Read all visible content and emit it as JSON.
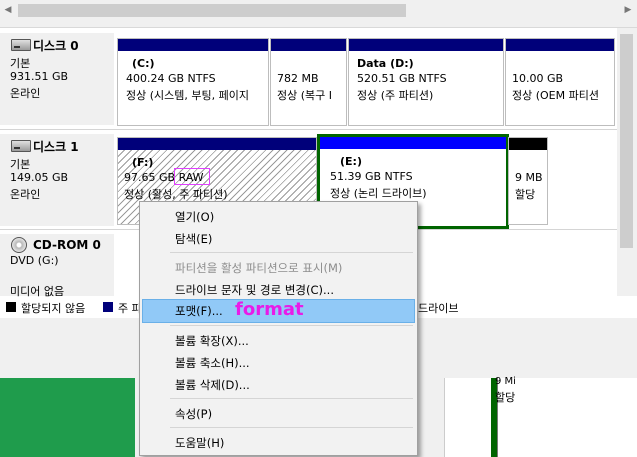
{
  "disks": [
    {
      "title": "디스크 0",
      "type": "기본",
      "size": "931.51 GB",
      "status": "온라인",
      "partitions": [
        {
          "name": "(C:)",
          "size": "400.24 GB NTFS",
          "status": "정상 (시스템, 부팅, 페이지"
        },
        {
          "name": "",
          "size": "782 MB",
          "status": "정상 (복구 I"
        },
        {
          "name": "Data  (D:)",
          "size": "520.51 GB NTFS",
          "status": "정상 (주 파티션)"
        },
        {
          "name": "",
          "size": "10.00 GB",
          "status": "정상 (OEM 파티션"
        }
      ]
    },
    {
      "title": "디스크 1",
      "type": "기본",
      "size": "149.05 GB",
      "status": "온라인",
      "partitions": [
        {
          "name": "(F:)",
          "size": "97.65 GB",
          "fs": "RAW",
          "status": "정상 (활성, 주 파티션)"
        },
        {
          "name": "(E:)",
          "size": "51.39 GB NTFS",
          "status": "정상 (논리 드라이브)"
        },
        {
          "name": "",
          "size": "9 MB",
          "status": "할당"
        }
      ]
    },
    {
      "title": "CD-ROM 0",
      "type": "DVD (G:)",
      "status": "미디어 없음"
    }
  ],
  "legend": [
    {
      "label": "할당되지 않음",
      "color": "#000000"
    },
    {
      "label": "주 파...",
      "color": "#00007a"
    },
    {
      "label": "드라이브",
      "color": "#0000ff"
    }
  ],
  "lower": {
    "size": "9 Mi",
    "status": "할당"
  },
  "context_menu": {
    "items": [
      {
        "label": "열기(O)",
        "disabled": false
      },
      {
        "label": "탐색(E)",
        "disabled": false
      },
      {
        "label": "파티션을 활성 파티션으로 표시(M)",
        "disabled": true
      },
      {
        "label": "드라이브 문자 및 경로 변경(C)...",
        "disabled": false
      },
      {
        "label": "포맷(F)...",
        "disabled": false,
        "highlighted": true
      },
      {
        "label": "볼륨 확장(X)...",
        "disabled": false
      },
      {
        "label": "볼륨 축소(H)...",
        "disabled": false
      },
      {
        "label": "볼륨 삭제(D)...",
        "disabled": false
      },
      {
        "label": "속성(P)",
        "disabled": false
      },
      {
        "label": "도움말(H)",
        "disabled": false
      }
    ],
    "annotation": "format"
  },
  "colors": {
    "unallocated": "#000000",
    "primary": "#00007a",
    "logical": "#0000ff",
    "selection": "#006400",
    "annotation": "#e81be8",
    "highlight": "#91c9f7"
  }
}
